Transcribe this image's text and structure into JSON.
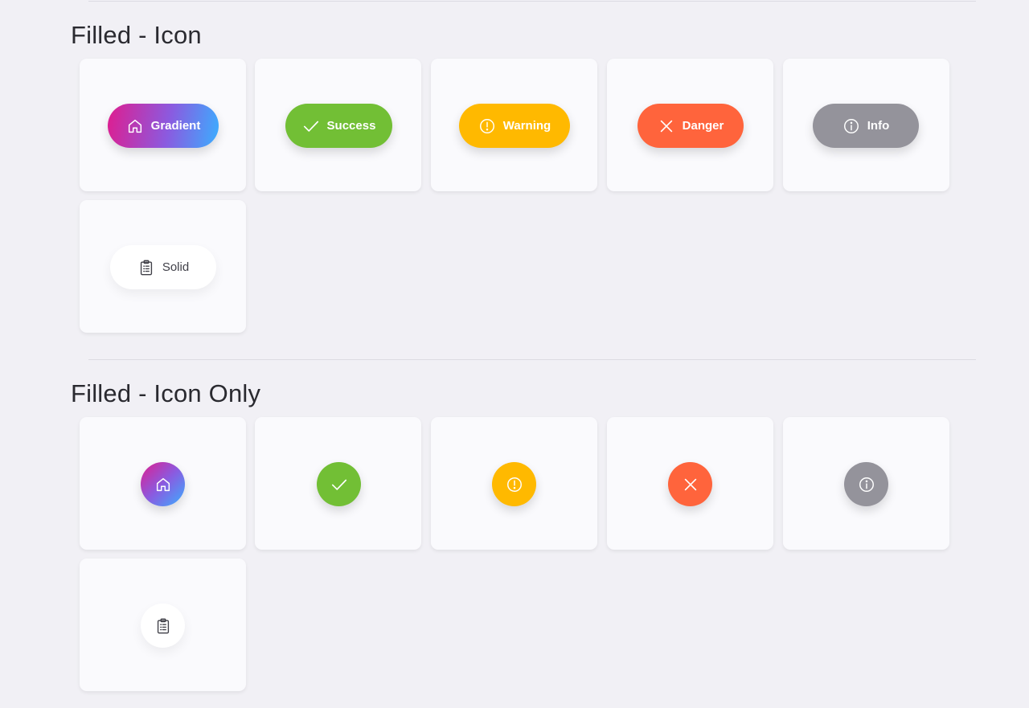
{
  "sections": [
    {
      "title": "Filled - Icon",
      "buttons": [
        {
          "label": "Gradient",
          "icon": "home-icon",
          "variant": "gradient"
        },
        {
          "label": "Success",
          "icon": "check-icon",
          "variant": "success"
        },
        {
          "label": "Warning",
          "icon": "alert-circle-icon",
          "variant": "warning"
        },
        {
          "label": "Danger",
          "icon": "close-icon",
          "variant": "danger"
        },
        {
          "label": "Info",
          "icon": "info-circle-icon",
          "variant": "info"
        },
        {
          "label": "Solid",
          "icon": "clipboard-icon",
          "variant": "solid"
        }
      ]
    },
    {
      "title": "Filled - Icon Only",
      "buttons": [
        {
          "icon": "home-icon",
          "variant": "gradient"
        },
        {
          "icon": "check-icon",
          "variant": "success"
        },
        {
          "icon": "alert-circle-icon",
          "variant": "warning"
        },
        {
          "icon": "close-icon",
          "variant": "danger"
        },
        {
          "icon": "info-circle-icon",
          "variant": "info"
        },
        {
          "icon": "clipboard-icon",
          "variant": "solid"
        }
      ]
    }
  ],
  "colors": {
    "gradient_start": "#df1d8f",
    "gradient_end": "#3aaeff",
    "success": "#72bf35",
    "warning": "#ffb900",
    "danger": "#ff643c",
    "info": "#94939b",
    "solid": "#ffffff",
    "background": "#f1f0f5",
    "card": "#fafafd"
  }
}
